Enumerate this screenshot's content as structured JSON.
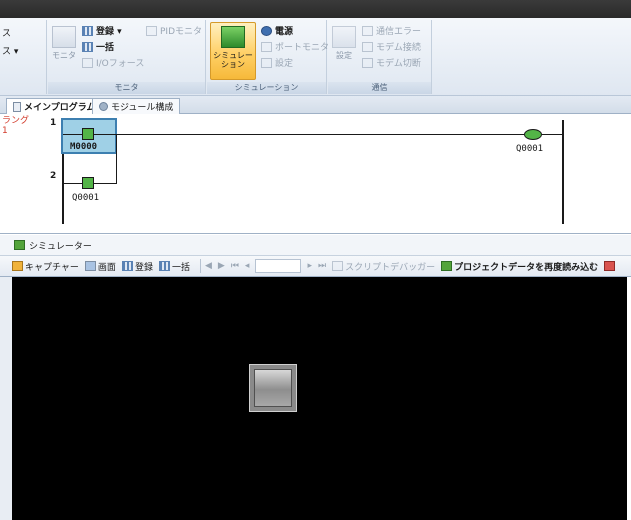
{
  "ribbon": {
    "clip_left": {
      "line1": "ス",
      "line2": "ス ▾"
    },
    "monitor_group": {
      "big_label": "モニタ",
      "register_label": "登録 ▾",
      "all_label": "一括",
      "io_force_label": "I/Oフォース",
      "pid_monitor_label": "PIDモニタ",
      "group_label": "モニタ"
    },
    "simulation_group": {
      "simulation_label_line1": "シミュレー",
      "simulation_label_line2": "ション",
      "power_label": "電源",
      "port_monitor_label": "ポートモニタ",
      "settings_label": "設定",
      "group_label": "シミュレーション"
    },
    "comm_group": {
      "settings_label": "設定",
      "comm_error_label": "通信エラー",
      "modem_connect_label": "モデム接続",
      "modem_disconnect_label": "モデム切断",
      "group_label": "通信"
    }
  },
  "tabs": [
    {
      "label": "メインプログラム",
      "active": true
    },
    {
      "label": "モジュール構成",
      "active": false
    }
  ],
  "ladder": {
    "side_note": {
      "line1": "ラング",
      "line2": "1"
    },
    "rungs": [
      {
        "number": "1",
        "contact": "M0000",
        "coil": "Q0001"
      },
      {
        "number": "2",
        "contact": "Q0001"
      }
    ]
  },
  "simulator": {
    "title": "シミュレーター",
    "toolbar": {
      "capture": "キャプチャー",
      "screen": "画面",
      "register": "登録",
      "all": "一括",
      "script_debugger": "スクリプトデバッガー",
      "reload_project": "プロジェクトデータを再度読み込む"
    }
  },
  "colors": {
    "accent_green": "#53b447",
    "cursor_highlight": "#9fd0e6",
    "canvas_bg": "#000000",
    "ribbon_bg": "#dfe7f1"
  }
}
